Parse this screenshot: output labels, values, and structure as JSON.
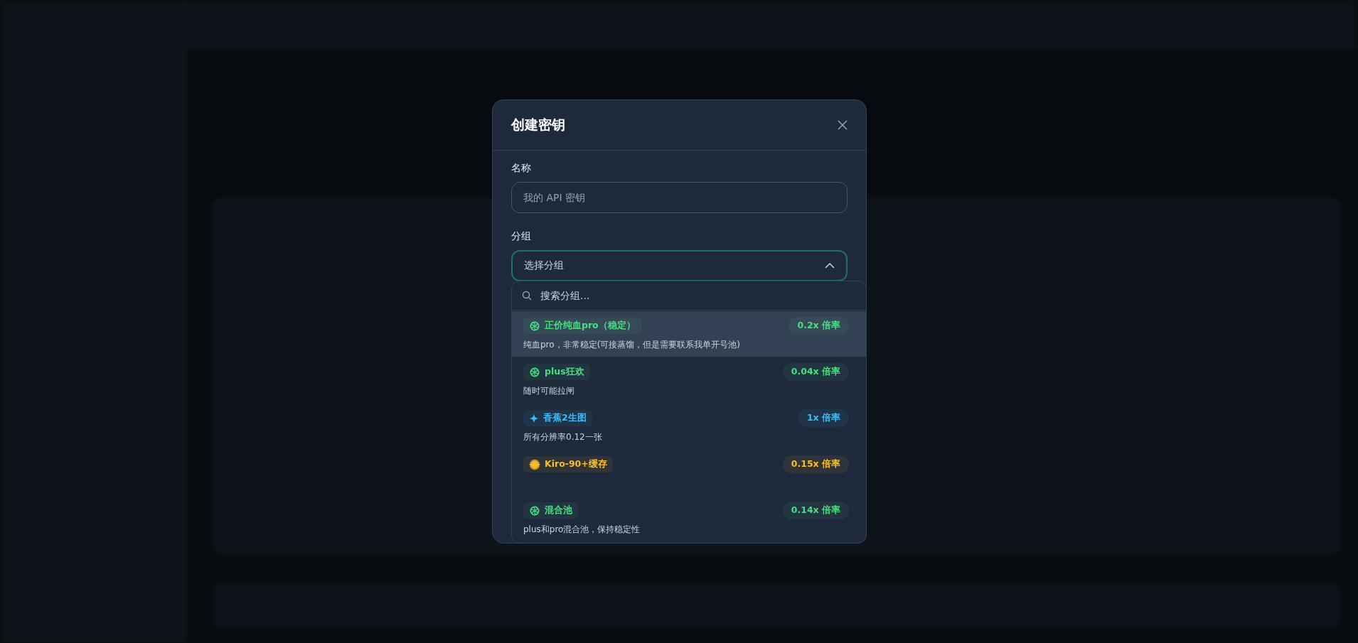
{
  "dialog": {
    "title": "创建密钥",
    "name_field": {
      "label": "名称",
      "placeholder": "我的 API 密钥"
    },
    "group_field": {
      "label": "分组",
      "placeholder": "选择分组",
      "expanded": true
    },
    "dropdown": {
      "search_placeholder": "搜索分组...",
      "options": [
        {
          "name": "正价纯血pro（稳定）",
          "kind": "openai",
          "color": "#4ade80",
          "rate": "0.2x 倍率",
          "description": "纯血pro，非常稳定(可接蒸馏，但是需要联系我单开号池)",
          "selected": true
        },
        {
          "name": "plus狂欢",
          "kind": "openai",
          "color": "#4ade80",
          "rate": "0.04x 倍率",
          "description": "随时可能拉闸",
          "selected": false
        },
        {
          "name": "香蕉2生图",
          "kind": "sparkle",
          "color": "#38bdf8",
          "rate": "1x 倍率",
          "description": "所有分辨率0.12一张",
          "selected": false
        },
        {
          "name": "Kiro-90+缓存",
          "kind": "burst",
          "color": "#fbbf24",
          "rate": "0.15x 倍率",
          "selected": false
        },
        {
          "name": "混合池",
          "kind": "openai",
          "color": "#4ade80",
          "rate": "0.14x 倍率",
          "description": "plus和pro混合池，保持稳定性",
          "selected": false
        }
      ]
    }
  }
}
